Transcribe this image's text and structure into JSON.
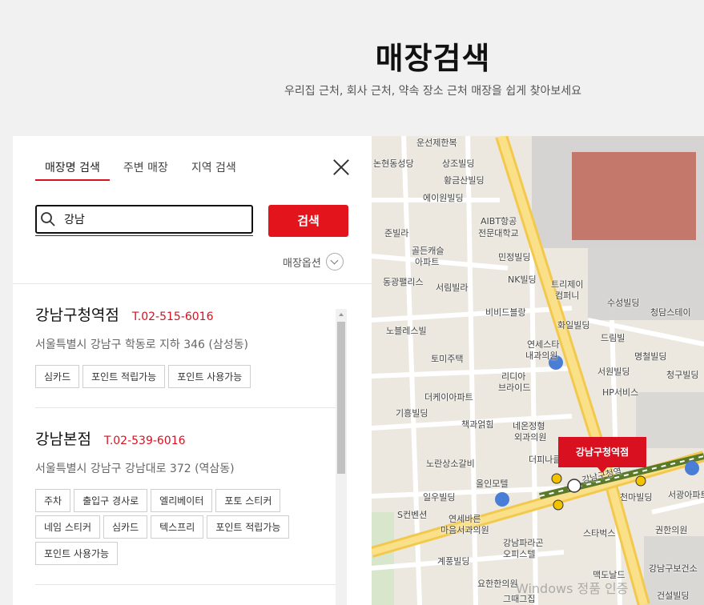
{
  "header": {
    "title": "매장검색",
    "subtitle": "우리집 근처, 회사 근처, 약속 장소 근처 매장을 쉽게 찾아보세요"
  },
  "tabs": [
    {
      "label": "매장명 검색",
      "active": true
    },
    {
      "label": "주변 매장",
      "active": false
    },
    {
      "label": "지역 검색",
      "active": false
    }
  ],
  "search": {
    "value": "강남",
    "button_label": "검색"
  },
  "options": {
    "label": "매장옵션"
  },
  "stores": [
    {
      "name": "강남구청역점",
      "phone": "T.02-515-6016",
      "address": "서울특별시 강남구 학동로 지하 346 (삼성동)",
      "tags": [
        "심카드",
        "포인트 적립가능",
        "포인트 사용가능"
      ]
    },
    {
      "name": "강남본점",
      "phone": "T.02-539-6016",
      "address": "서울특별시 강남구 강남대로 372 (역삼동)",
      "tags": [
        "주차",
        "출입구 경사로",
        "엘리베이터",
        "포토 스티커",
        "네임 스티커",
        "심카드",
        "텍스프리",
        "포인트 적립가능",
        "포인트 사용가능"
      ]
    }
  ],
  "map": {
    "marker_label": "강남구청역점",
    "labels": [
      "운선제한복",
      "논현동성당",
      "상조빌딩",
      "황금산빌딩",
      "에이원빌딩",
      "AIBT항공",
      "전문대학교",
      "준빌라",
      "골든캐슬",
      "아파트",
      "민정빌딩",
      "동광팰리스",
      "서림빌라",
      "NK빌딩",
      "트리제이",
      "컴퍼니",
      "비비드블랑",
      "수성빌딩",
      "청담스테이",
      "노블레스빌",
      "화일빌딩",
      "드림빌",
      "연세스타",
      "내과의원",
      "토미주택",
      "명철빌딩",
      "서원빌딩",
      "청구빌딩",
      "리디아",
      "브라이드",
      "더케이아파트",
      "HP서비스",
      "기흥빌딩",
      "책과얽힘",
      "네온정형",
      "외과의원",
      "노란상소갈비",
      "더피나클",
      "올인모텔",
      "일우빌딩",
      "천마빌딩",
      "서광아파트",
      "S컨벤션",
      "연세바른",
      "마음서과의원",
      "강남파라곤",
      "오피스텔",
      "스타벅스",
      "권한의원",
      "계풍빌딩",
      "요한한의원",
      "맥도날드",
      "강남구보건소",
      "그때그집",
      "건설빌딩",
      "강남구청역"
    ],
    "watermark": "Windows 정품 인증"
  }
}
